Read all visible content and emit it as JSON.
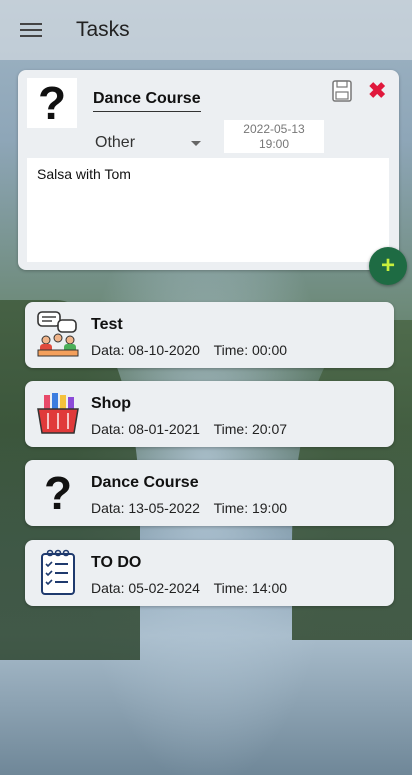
{
  "appbar": {
    "title": "Tasks"
  },
  "editor": {
    "name": "Dance Course",
    "icon_glyph": "?",
    "category": "Other",
    "date": "2022-05-13",
    "time": "19:00",
    "description": "Salsa with Tom",
    "add_label": "+"
  },
  "tasks": [
    {
      "title": "Test",
      "icon": "meeting-icon",
      "data": "Data: 08-10-2020",
      "time": "Time: 00:00"
    },
    {
      "title": "Shop",
      "icon": "shopping-basket-icon",
      "data": "Data: 08-01-2021",
      "time": "Time: 20:07"
    },
    {
      "title": "Dance Course",
      "icon": "question-mark-icon",
      "data": "Data: 13-05-2022",
      "time": "Time: 19:00"
    },
    {
      "title": "TO DO",
      "icon": "checklist-icon",
      "data": "Data: 05-02-2024",
      "time": "Time: 14:00"
    }
  ],
  "colors": {
    "accent_green": "#1e6b43",
    "close_red": "#e0183c"
  }
}
